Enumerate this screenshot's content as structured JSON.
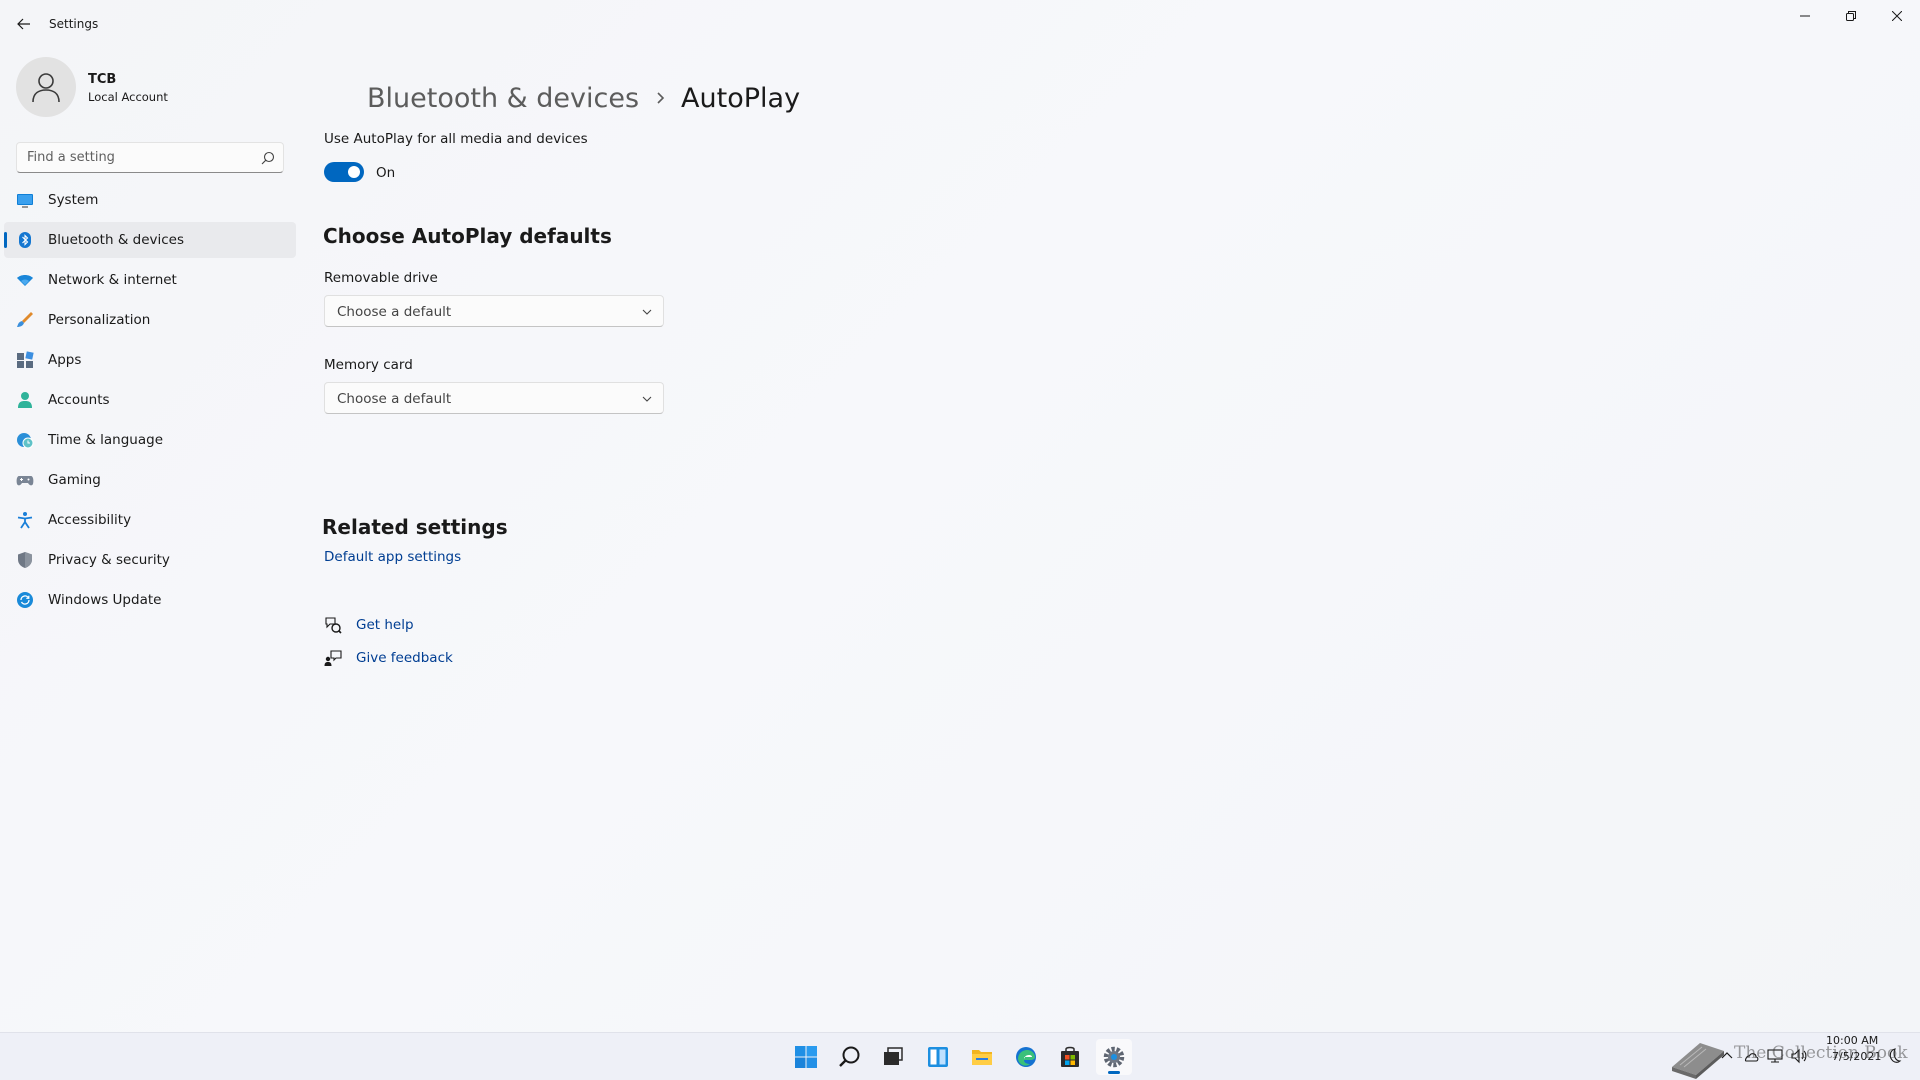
{
  "window": {
    "app_title": "Settings"
  },
  "profile": {
    "name": "TCB",
    "account_type": "Local Account"
  },
  "search": {
    "placeholder": "Find a setting"
  },
  "sidebar": {
    "items": [
      {
        "label": "System",
        "icon": "monitor-icon"
      },
      {
        "label": "Bluetooth & devices",
        "icon": "bluetooth-icon",
        "active": true
      },
      {
        "label": "Network & internet",
        "icon": "wifi-icon"
      },
      {
        "label": "Personalization",
        "icon": "brush-icon"
      },
      {
        "label": "Apps",
        "icon": "apps-icon"
      },
      {
        "label": "Accounts",
        "icon": "person-icon"
      },
      {
        "label": "Time & language",
        "icon": "globe-clock-icon"
      },
      {
        "label": "Gaming",
        "icon": "gamepad-icon"
      },
      {
        "label": "Accessibility",
        "icon": "accessibility-icon"
      },
      {
        "label": "Privacy & security",
        "icon": "shield-icon"
      },
      {
        "label": "Windows Update",
        "icon": "update-icon"
      }
    ]
  },
  "breadcrumb": {
    "parent": "Bluetooth & devices",
    "current": "AutoPlay"
  },
  "autoplay": {
    "toggle_label": "Use AutoPlay for all media and devices",
    "toggle_state": "On",
    "toggle_on": true
  },
  "defaults": {
    "section_title": "Choose AutoPlay defaults",
    "removable_drive": {
      "label": "Removable drive",
      "value": "Choose a default"
    },
    "memory_card": {
      "label": "Memory card",
      "value": "Choose a default"
    }
  },
  "related": {
    "section_title": "Related settings",
    "default_apps_link": "Default app settings"
  },
  "help": {
    "get_help": "Get help",
    "give_feedback": "Give feedback"
  },
  "taskbar": {
    "apps": [
      "start-icon",
      "search-icon",
      "task-view-icon",
      "widgets-icon",
      "file-explorer-icon",
      "edge-icon",
      "store-icon",
      "settings-icon"
    ],
    "active_app": "settings-icon",
    "time": "10:00 AM",
    "date": "7/5/2021",
    "watermark": "The Collection Book"
  },
  "colors": {
    "accent": "#0067c0",
    "link": "#003e92",
    "background": "#f3f3f3"
  }
}
